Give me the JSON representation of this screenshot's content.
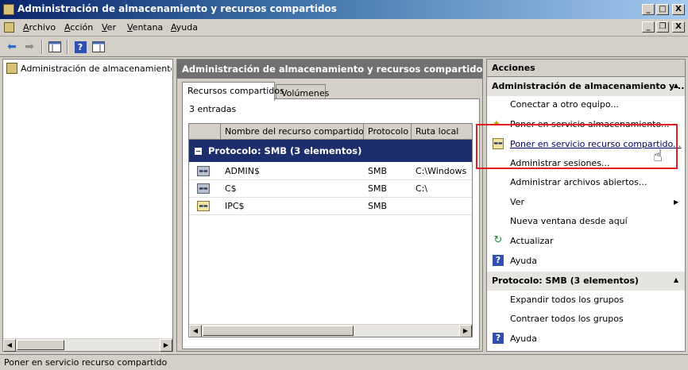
{
  "window": {
    "title": "Administración de almacenamiento y recursos compartidos",
    "minimize": "_",
    "maximize": "□",
    "close": "X",
    "inner_minimize": "_",
    "inner_restore": "❐",
    "inner_close": "X"
  },
  "menu": [
    {
      "accel": "A",
      "rest": "rchivo"
    },
    {
      "accel": "A",
      "rest": "cción"
    },
    {
      "accel": "V",
      "rest": "er"
    },
    {
      "accel": "V",
      "rest": "entana"
    },
    {
      "accel": "A",
      "rest": "yuda"
    }
  ],
  "toolbar": {
    "icons": [
      "back-arrow-icon",
      "forward-arrow-icon",
      "show-hide-tree-icon",
      "help-icon",
      "properties-icon"
    ],
    "back": "⬅",
    "forward": "➡",
    "help": "?"
  },
  "tree": {
    "root_label": "Administración de almacenamiento y re"
  },
  "center": {
    "header": "Administración de almacenamiento y recursos compartidos (Local)",
    "tabs": [
      "Recursos compartidos",
      "Volúmenes"
    ],
    "entry_count": "3 entradas",
    "columns": [
      "Nombre del recurso compartido",
      "Protocolo",
      "Ruta local"
    ],
    "group": "Protocolo: SMB (3 elementos)",
    "group_toggle": "−",
    "rows": [
      {
        "name": "ADMIN$",
        "protocol": "SMB",
        "path": "C:\\Windows",
        "icon": "share-folder-icon"
      },
      {
        "name": "C$",
        "protocol": "SMB",
        "path": "C:\\",
        "icon": "share-folder-icon"
      },
      {
        "name": "IPC$",
        "protocol": "SMB",
        "path": "",
        "icon": "ipc-share-icon"
      }
    ]
  },
  "actions": {
    "title": "Acciones",
    "section1": "Administración de almacenamiento y ...",
    "section1_items": [
      "Conectar a otro equipo...",
      "Poner en servicio almacenamiento...",
      "Poner en servicio recurso compartido...",
      "Administrar sesiones...",
      "Administrar archivos abiertos...",
      "Ver",
      "Nueva ventana desde aquí",
      "Actualizar",
      "Ayuda"
    ],
    "ver_arrow": "▶",
    "section2": "Protocolo: SMB (3 elementos)",
    "section2_items": [
      "Expandir todos los grupos",
      "Contraer todos los grupos",
      "Ayuda"
    ],
    "collapse_arrow": "▲"
  },
  "status": {
    "text": "Poner en servicio recurso compartido"
  },
  "colors": {
    "title_gradient_start": "#0a246a",
    "group_header": "#1c2f6c",
    "pane_header": "#707070",
    "highlight_box": "#e02020"
  }
}
